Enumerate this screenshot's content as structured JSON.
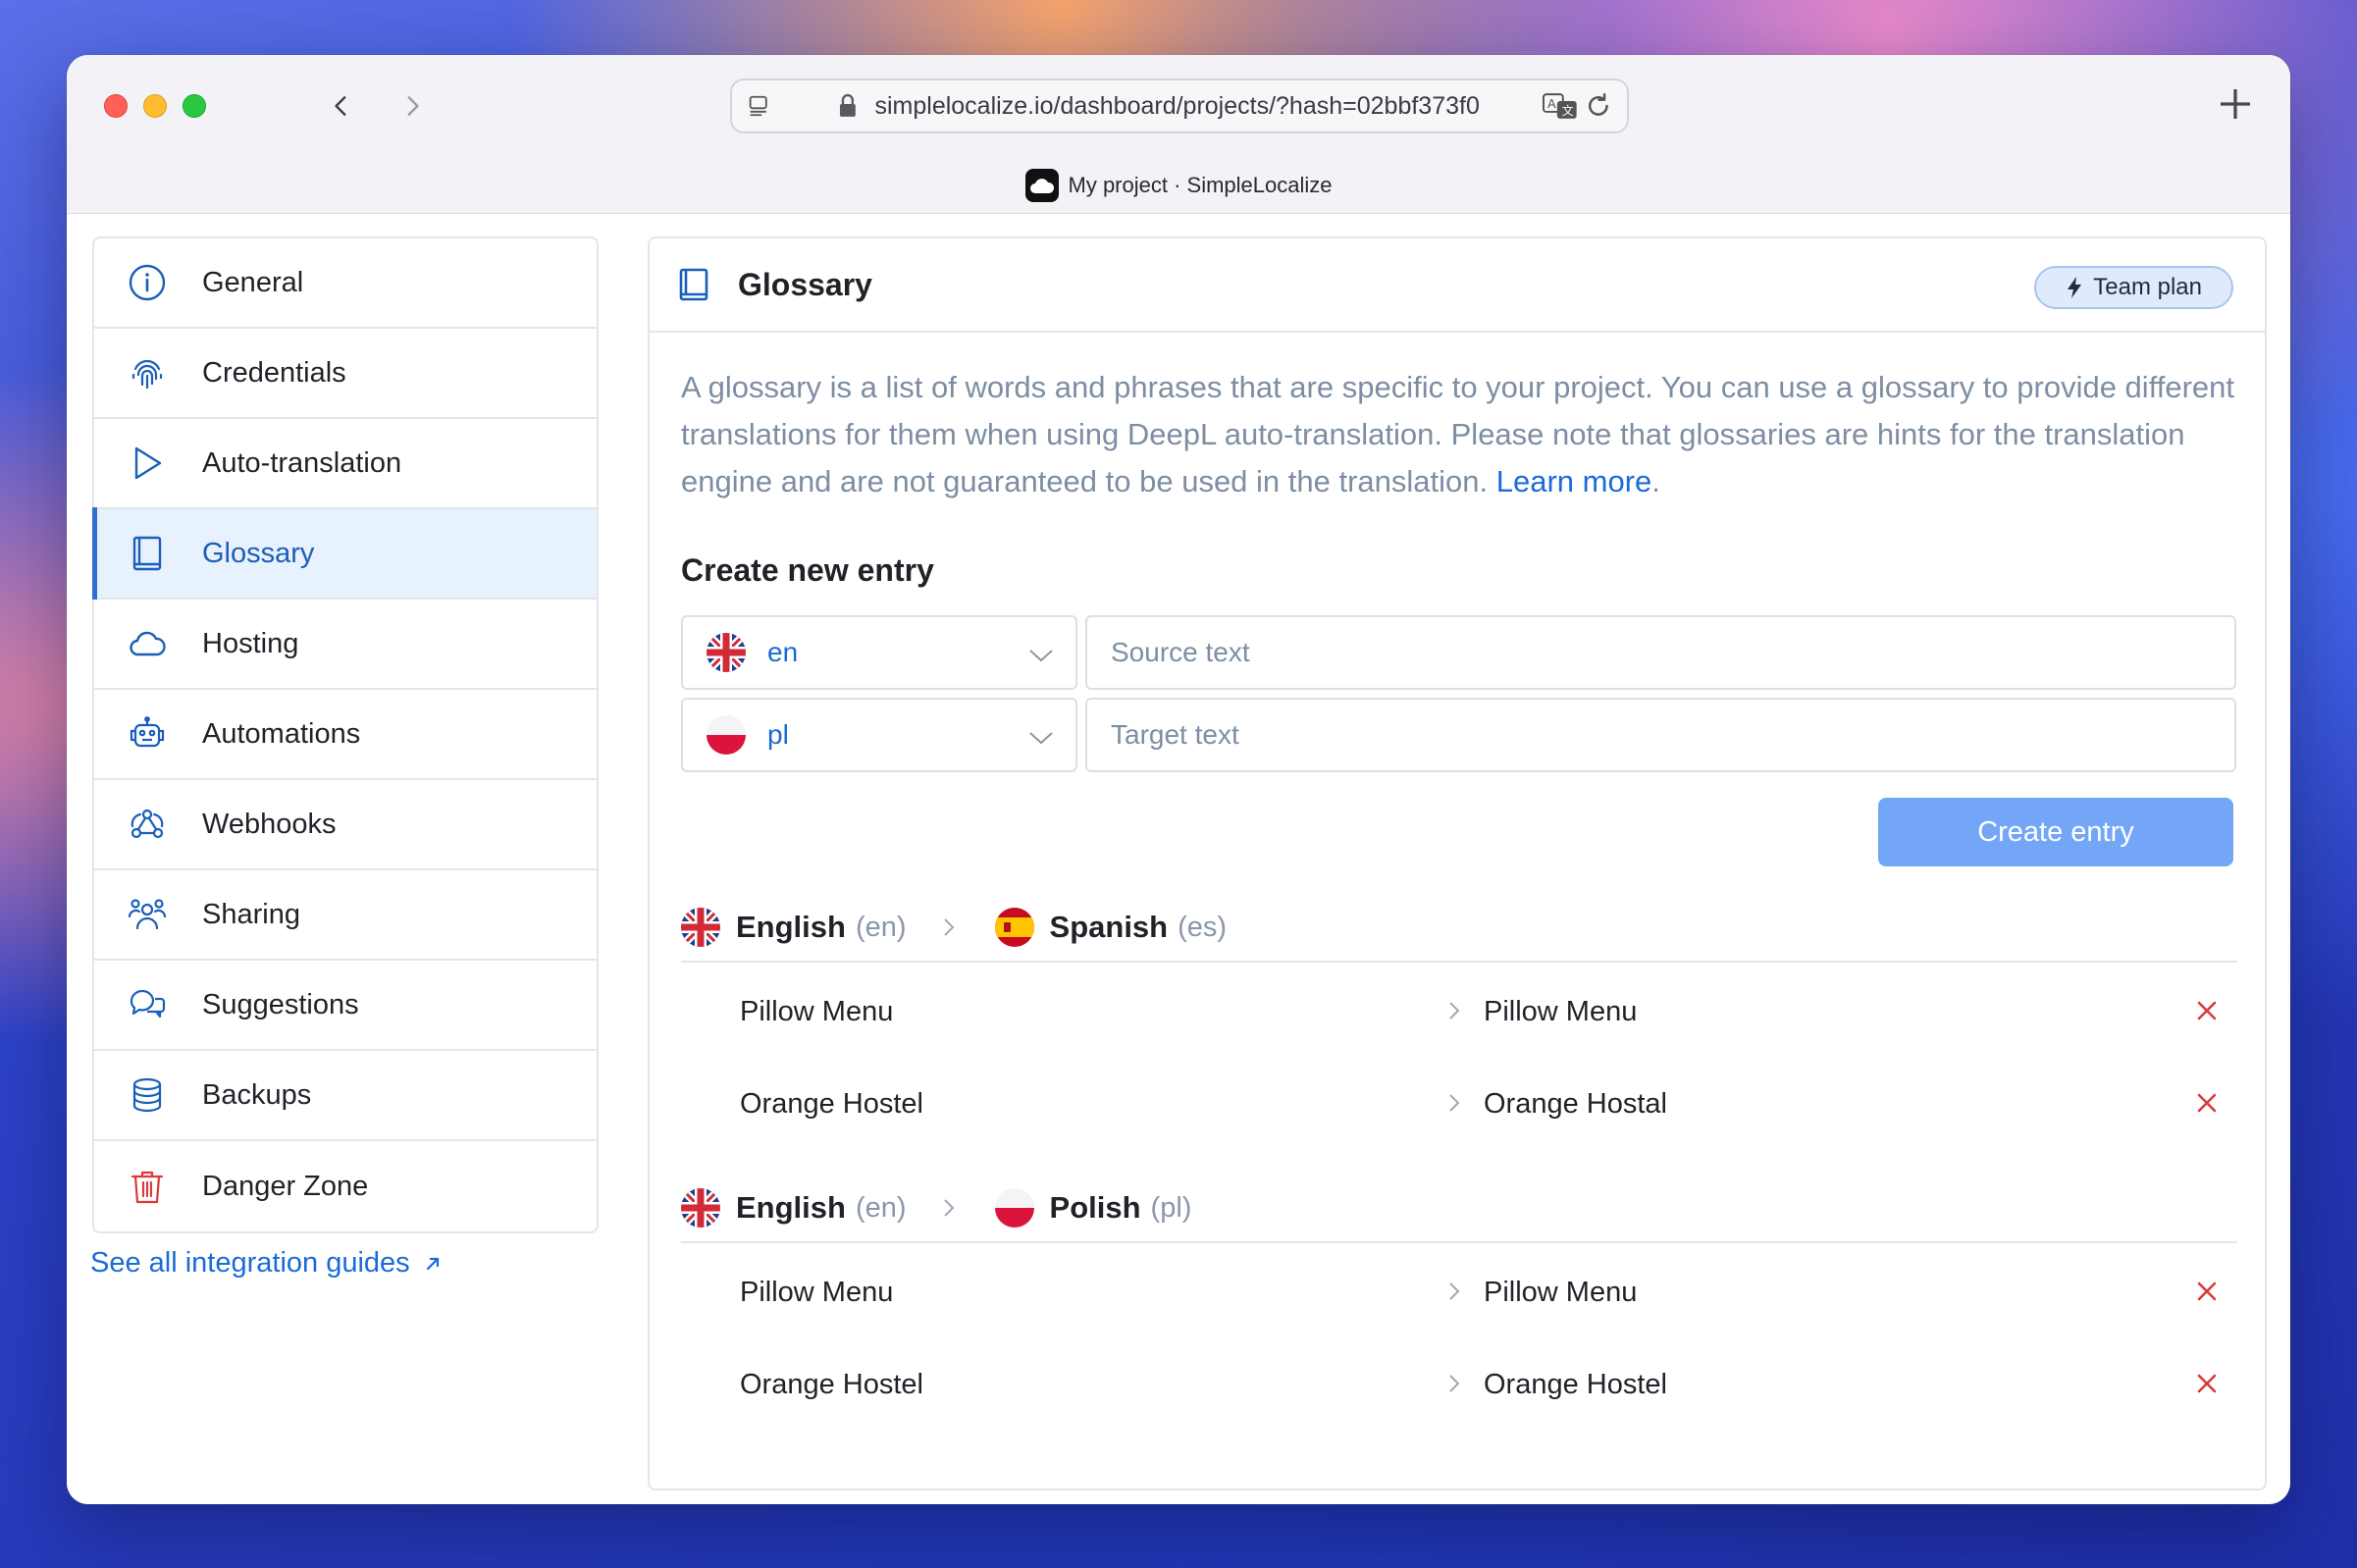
{
  "browser": {
    "url": "simplelocalize.io/dashboard/projects/?hash=02bbf373f0",
    "tab_title": "My project · SimpleLocalize"
  },
  "sidebar": {
    "items": [
      {
        "label": "General",
        "icon": "info-icon"
      },
      {
        "label": "Credentials",
        "icon": "fingerprint-icon"
      },
      {
        "label": "Auto-translation",
        "icon": "play-icon"
      },
      {
        "label": "Glossary",
        "icon": "book-icon",
        "active": true
      },
      {
        "label": "Hosting",
        "icon": "cloud-icon"
      },
      {
        "label": "Automations",
        "icon": "robot-icon"
      },
      {
        "label": "Webhooks",
        "icon": "webhook-icon"
      },
      {
        "label": "Sharing",
        "icon": "users-icon"
      },
      {
        "label": "Suggestions",
        "icon": "chat-icon"
      },
      {
        "label": "Backups",
        "icon": "database-icon"
      },
      {
        "label": "Danger Zone",
        "icon": "trash-icon"
      }
    ],
    "guides_link": "See all integration guides"
  },
  "panel": {
    "title": "Glossary",
    "plan_badge": "Team plan",
    "description": "A glossary is a list of words and phrases that are specific to your project. You can use a glossary to provide different translations for them when using DeepL auto-translation. Please note that glossaries are hints for the translation engine and are not guaranteed to be used in the translation.",
    "learn_more": "Learn more",
    "create_title": "Create new entry",
    "source_lang": "en",
    "target_lang": "pl",
    "source_placeholder": "Source text",
    "target_placeholder": "Target text",
    "create_button": "Create entry"
  },
  "glossaries": [
    {
      "source": {
        "name": "English",
        "code": "(en)"
      },
      "target": {
        "name": "Spanish",
        "code": "(es)"
      },
      "entries": [
        {
          "source": "Pillow Menu",
          "target": "Pillow Menu"
        },
        {
          "source": "Orange Hostel",
          "target": "Orange Hostal"
        }
      ]
    },
    {
      "source": {
        "name": "English",
        "code": "(en)"
      },
      "target": {
        "name": "Polish",
        "code": "(pl)"
      },
      "entries": [
        {
          "source": "Pillow Menu",
          "target": "Pillow Menu"
        },
        {
          "source": "Orange Hostel",
          "target": "Orange Hostel"
        }
      ]
    }
  ],
  "colors": {
    "accent": "#1a6bd8",
    "button": "#73a6f7",
    "delete": "#d93a3a",
    "active_bg": "#e8f1fe"
  }
}
